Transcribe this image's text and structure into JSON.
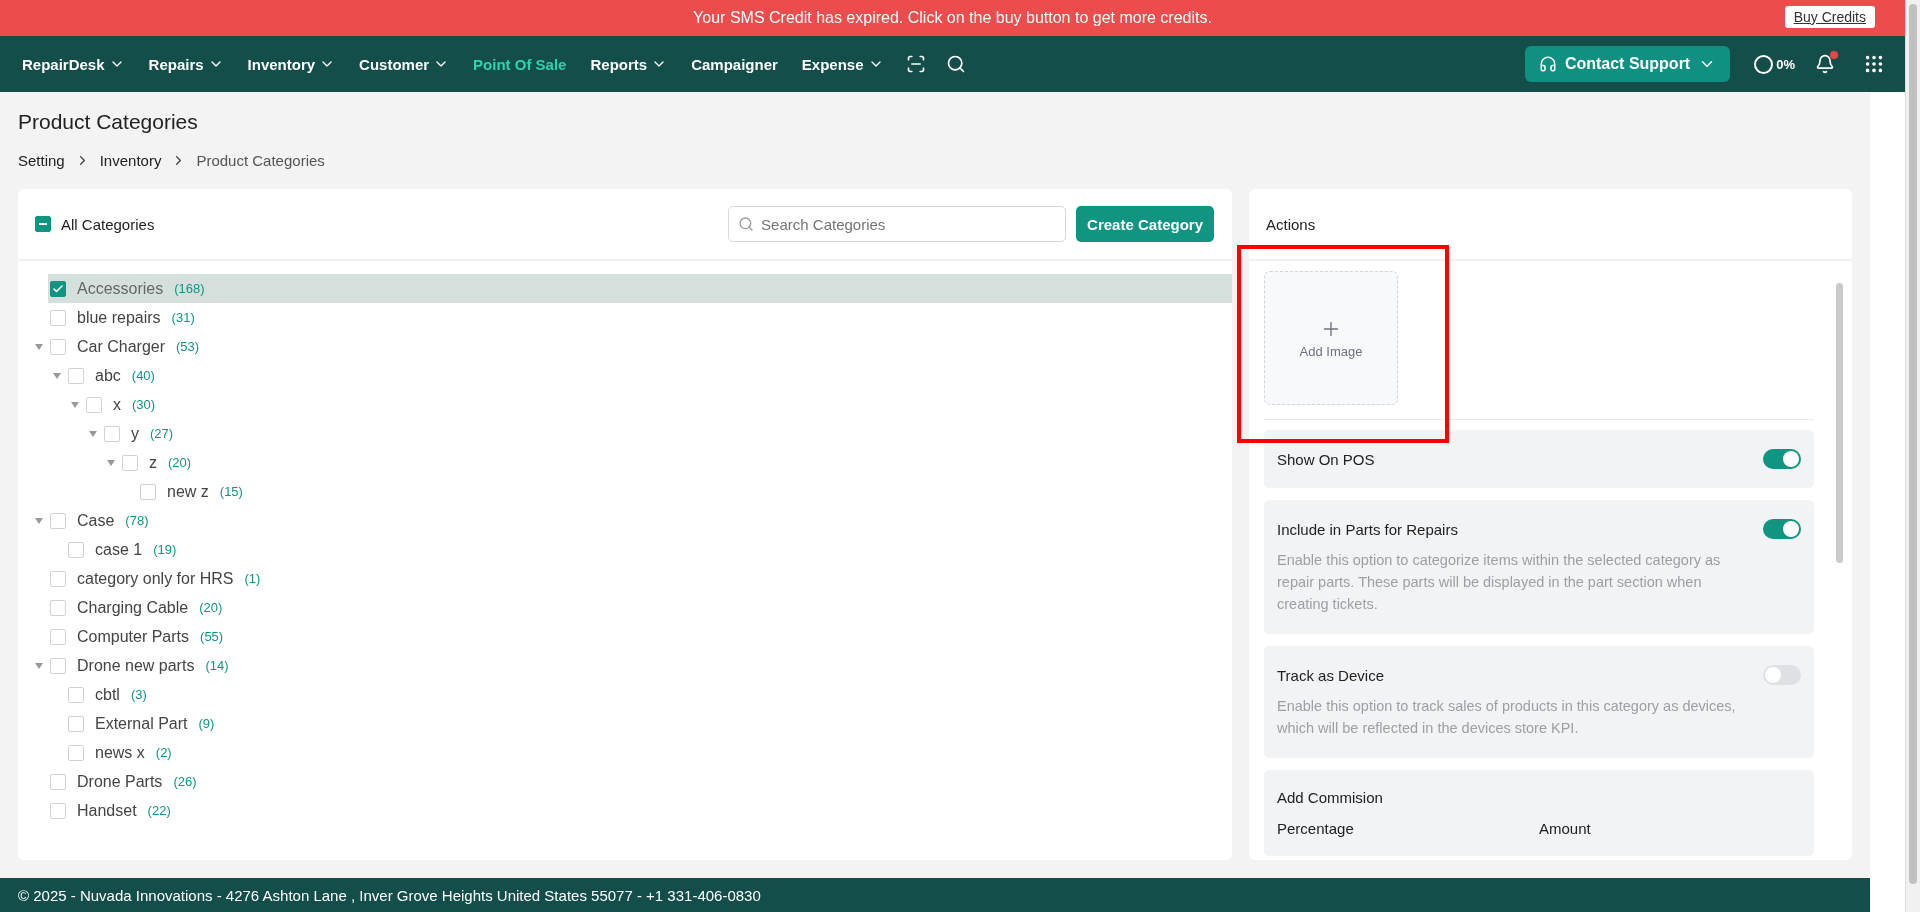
{
  "banner": {
    "message": "Your SMS Credit has expired. Click on the buy button to get more credits.",
    "button": "Buy Credits"
  },
  "nav": {
    "items": [
      {
        "label": "RepairDesk",
        "dropdown": true,
        "selected": false
      },
      {
        "label": "Repairs",
        "dropdown": true,
        "selected": false
      },
      {
        "label": "Inventory",
        "dropdown": true,
        "selected": false
      },
      {
        "label": "Customer",
        "dropdown": true,
        "selected": false
      },
      {
        "label": "Point Of Sale",
        "dropdown": false,
        "selected": true
      },
      {
        "label": "Reports",
        "dropdown": true,
        "selected": false
      },
      {
        "label": "Campaigner",
        "dropdown": false,
        "selected": false
      },
      {
        "label": "Expense",
        "dropdown": true,
        "selected": false
      }
    ],
    "support_button": "Contact Support",
    "progress": "0%",
    "unread_notifications": true
  },
  "page": {
    "title": "Product Categories",
    "breadcrumb": [
      "Setting",
      "Inventory",
      "Product Categories"
    ]
  },
  "categories": {
    "select_all": {
      "label": "All Categories",
      "indeterminate": true
    },
    "search": {
      "placeholder": "Search Categories"
    },
    "create_button": "Create Category",
    "tree": [
      {
        "name": "Accessories",
        "count": "(168)",
        "checked": true,
        "selected": true
      },
      {
        "name": "blue repairs",
        "count": "(31)",
        "checked": false,
        "selected": false
      },
      {
        "name": "Car Charger",
        "count": "(53)",
        "checked": false,
        "selected": false,
        "expanded": true,
        "children": [
          {
            "name": "abc",
            "count": "(40)",
            "checked": false,
            "selected": false,
            "expanded": true,
            "children": [
              {
                "name": "x",
                "count": "(30)",
                "checked": false,
                "selected": false,
                "expanded": true,
                "children": [
                  {
                    "name": "y",
                    "count": "(27)",
                    "checked": false,
                    "selected": false,
                    "expanded": true,
                    "children": [
                      {
                        "name": "z",
                        "count": "(20)",
                        "checked": false,
                        "selected": false,
                        "expanded": true,
                        "children": [
                          {
                            "name": "new z",
                            "count": "(15)",
                            "checked": false,
                            "selected": false
                          }
                        ]
                      }
                    ]
                  }
                ]
              }
            ]
          }
        ]
      },
      {
        "name": "Case",
        "count": "(78)",
        "checked": false,
        "selected": false,
        "expanded": true,
        "children": [
          {
            "name": "case 1",
            "count": "(19)",
            "checked": false,
            "selected": false
          }
        ]
      },
      {
        "name": "category only for HRS",
        "count": "(1)",
        "checked": false,
        "selected": false
      },
      {
        "name": "Charging Cable",
        "count": "(20)",
        "checked": false,
        "selected": false
      },
      {
        "name": "Computer Parts",
        "count": "(55)",
        "checked": false,
        "selected": false
      },
      {
        "name": "Drone new parts",
        "count": "(14)",
        "checked": false,
        "selected": false,
        "expanded": true,
        "children": [
          {
            "name": "cbtl",
            "count": "(3)",
            "checked": false,
            "selected": false
          },
          {
            "name": "External Part",
            "count": "(9)",
            "checked": false,
            "selected": false
          },
          {
            "name": "news x",
            "count": "(2)",
            "checked": false,
            "selected": false
          }
        ]
      },
      {
        "name": "Drone Parts",
        "count": "(26)",
        "checked": false,
        "selected": false
      },
      {
        "name": "Handset",
        "count": "(22)",
        "checked": false,
        "selected": false
      }
    ]
  },
  "actions": {
    "title": "Actions",
    "add_image": "Add Image",
    "settings": [
      {
        "title": "Show On POS",
        "on": true
      },
      {
        "title": "Include in Parts for Repairs",
        "description": "Enable this option to categorize items within the selected category as repair parts. These parts will be displayed in the part section when creating tickets.",
        "on": true
      },
      {
        "title": "Track as Device",
        "description": "Enable this option to track sales of products in this category as devices, which will be reflected in the devices store KPI.",
        "on": false
      }
    ],
    "commission": {
      "title": "Add Commision",
      "fields": [
        "Percentage",
        "Amount"
      ]
    }
  },
  "footer": "© 2025 - Nuvada Innovations - 4276 Ashton Lane , Inver Grove Heights United States 55077 - +1 331-406-0830"
}
